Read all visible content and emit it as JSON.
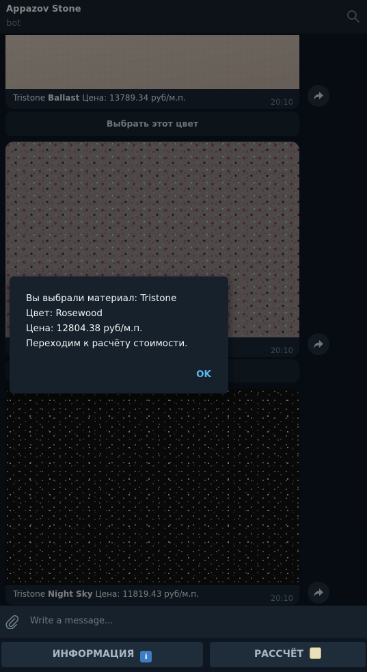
{
  "header": {
    "title": "Appazov Stone",
    "status": "bot"
  },
  "messages": [
    {
      "brand": "Tristone",
      "color_name": "Ballast",
      "price_text": "Цена: 13789.34 руб/м.п.",
      "time": "20:10",
      "button": "Выбрать этот цвет"
    },
    {
      "time": "20:10"
    },
    {
      "brand": "Tristone",
      "color_name": "Night Sky",
      "price_text": "Цена: 11819.43 руб/м.п.",
      "time": "20:10"
    }
  ],
  "dialog": {
    "lines": [
      "Вы выбрали материал: Tristone",
      "Цвет: Rosewood",
      "Цена: 12804.38 руб/м.п.",
      "Переходим к расчёту стоимости."
    ],
    "ok": "OK"
  },
  "input": {
    "placeholder": "Write a message..."
  },
  "keyboard": [
    {
      "label": "ИНФОРМАЦИЯ",
      "emoji": "ℹ️"
    },
    {
      "label": "РАССЧЁТ",
      "emoji": "📝"
    }
  ],
  "colors": {
    "accent": "#5fb4ef",
    "background": "#0e1621",
    "panel": "#17212b"
  }
}
